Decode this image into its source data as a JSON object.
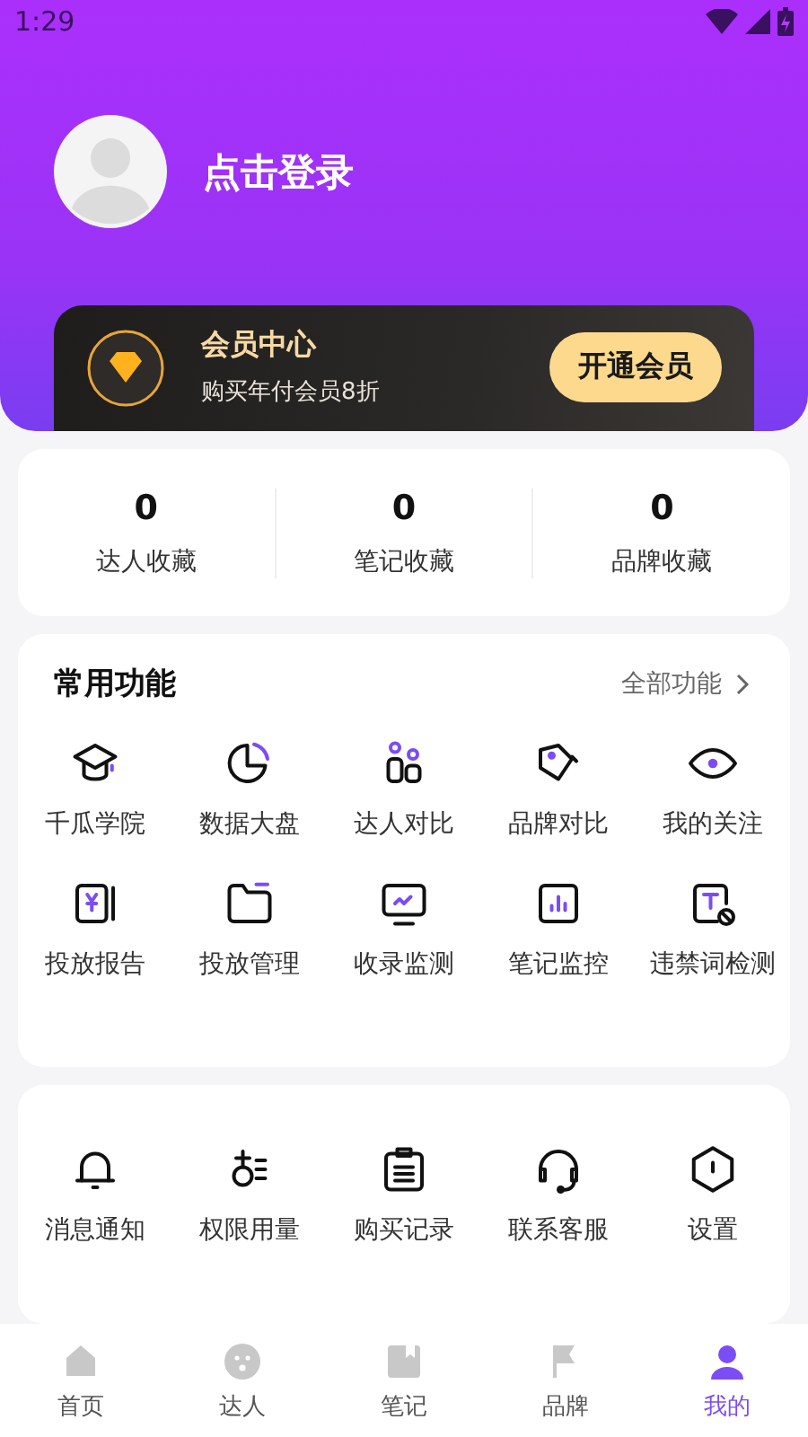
{
  "status_bar": {
    "time": "1:29"
  },
  "profile": {
    "login_label": "点击登录"
  },
  "membership": {
    "title": "会员中心",
    "subtitle": "购买年付会员8折",
    "button": "开通会员"
  },
  "stats": [
    {
      "value": "0",
      "label": "达人收藏"
    },
    {
      "value": "0",
      "label": "笔记收藏"
    },
    {
      "value": "0",
      "label": "品牌收藏"
    }
  ],
  "common_functions": {
    "title": "常用功能",
    "more_link": "全部功能",
    "items": [
      {
        "label": "千瓜学院"
      },
      {
        "label": "数据大盘"
      },
      {
        "label": "达人对比"
      },
      {
        "label": "品牌对比"
      },
      {
        "label": "我的关注"
      },
      {
        "label": "投放报告"
      },
      {
        "label": "投放管理"
      },
      {
        "label": "收录监测"
      },
      {
        "label": "笔记监控"
      },
      {
        "label": "违禁词检测"
      }
    ]
  },
  "tools": {
    "items": [
      {
        "label": "消息通知"
      },
      {
        "label": "权限用量"
      },
      {
        "label": "购买记录"
      },
      {
        "label": "联系客服"
      },
      {
        "label": "设置"
      }
    ]
  },
  "bottom_nav": [
    {
      "label": "首页",
      "selected": false
    },
    {
      "label": "达人",
      "selected": false
    },
    {
      "label": "笔记",
      "selected": false
    },
    {
      "label": "品牌",
      "selected": false
    },
    {
      "label": "我的",
      "selected": true
    }
  ]
}
